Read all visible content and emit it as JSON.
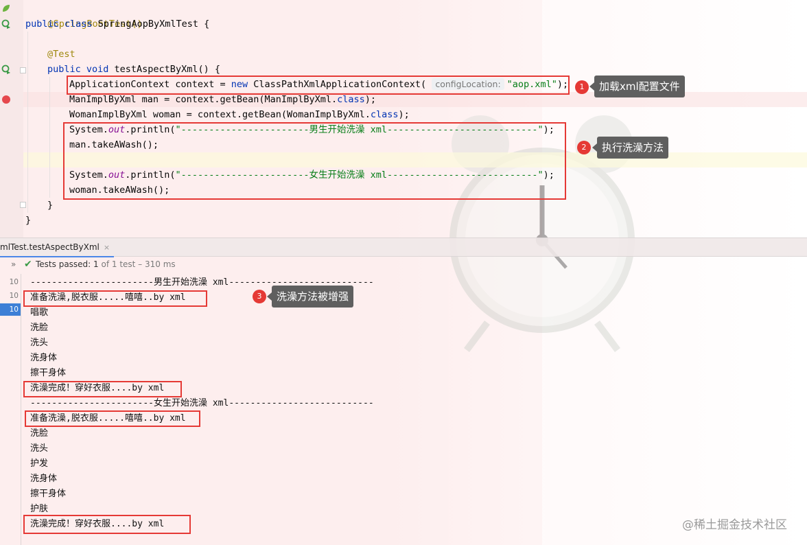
{
  "editor": {
    "lines": {
      "annotation_class": "@SpringBootTest()",
      "class_kw": "public class",
      "class_name": " SpringAopByXmlTest {",
      "annotation_test": "@Test",
      "method_kw": "public void",
      "method_name": " testAspectByXml() {",
      "ctx_type": "ApplicationContext context = ",
      "ctx_new": "new",
      "ctx_class": " ClassPathXmlApplicationContext(",
      "ctx_hint": "configLocation:",
      "ctx_arg": "\"aop.xml\"",
      "ctx_end": ");",
      "man_decl": "ManImplByXml man = context.getBean(ManImplByXml.",
      "man_cls": "class",
      "man_end": ");",
      "woman_decl": "WomanImplByXml woman = context.getBean(WomanImplByXml.",
      "woman_cls": "class",
      "woman_end": ");",
      "sys1_a": "System.",
      "sys1_out": "out",
      "sys1_b": ".println(",
      "sys1_str": "\"-----------------------男生开始洗澡 xml---------------------------\"",
      "sys1_end": ");",
      "man_wash": "man.takeAWash();",
      "sys2_a": "System.",
      "sys2_out": "out",
      "sys2_b": ".println(",
      "sys2_str": "\"-----------------------女生开始洗澡 xml---------------------------\"",
      "sys2_end": ");",
      "woman_wash": "woman.takeAWash();",
      "close_method": "}",
      "close_class": "}"
    }
  },
  "callouts": [
    {
      "num": "1",
      "text": "加载xml配置文件"
    },
    {
      "num": "2",
      "text": "执行洗澡方法"
    },
    {
      "num": "3",
      "text": "洗澡方法被增强"
    }
  ],
  "run": {
    "tab_label": "mlTest.testAspectByXml",
    "tab_close": "×",
    "status_prefix": "Tests passed:",
    "status_count": " 1",
    "status_rest": " of 1 test – 310 ms",
    "timings": [
      "10 ms",
      "10 ms",
      "10 ms"
    ],
    "output": [
      "-----------------------男生开始洗澡 xml---------------------------",
      "准备洗澡,脱衣服.....嘻嘻..by xml",
      "唱歌",
      "洗脸",
      "洗头",
      "洗身体",
      "擦干身体",
      "洗澡完成！穿好衣服....by xml",
      "-----------------------女生开始洗澡 xml---------------------------",
      "准备洗澡,脱衣服.....嘻嘻..by xml",
      "洗脸",
      "洗头",
      "护发",
      "洗身体",
      "擦干身体",
      "护肤",
      "洗澡完成！穿好衣服....by xml"
    ]
  },
  "watermark": "@稀土掘金技术社区",
  "colors": {
    "highlight_box": "#e53935",
    "callout_bg": "#5f5f5f",
    "keyword": "#0033b3",
    "string": "#067d17",
    "pass": "#3a9a46"
  }
}
